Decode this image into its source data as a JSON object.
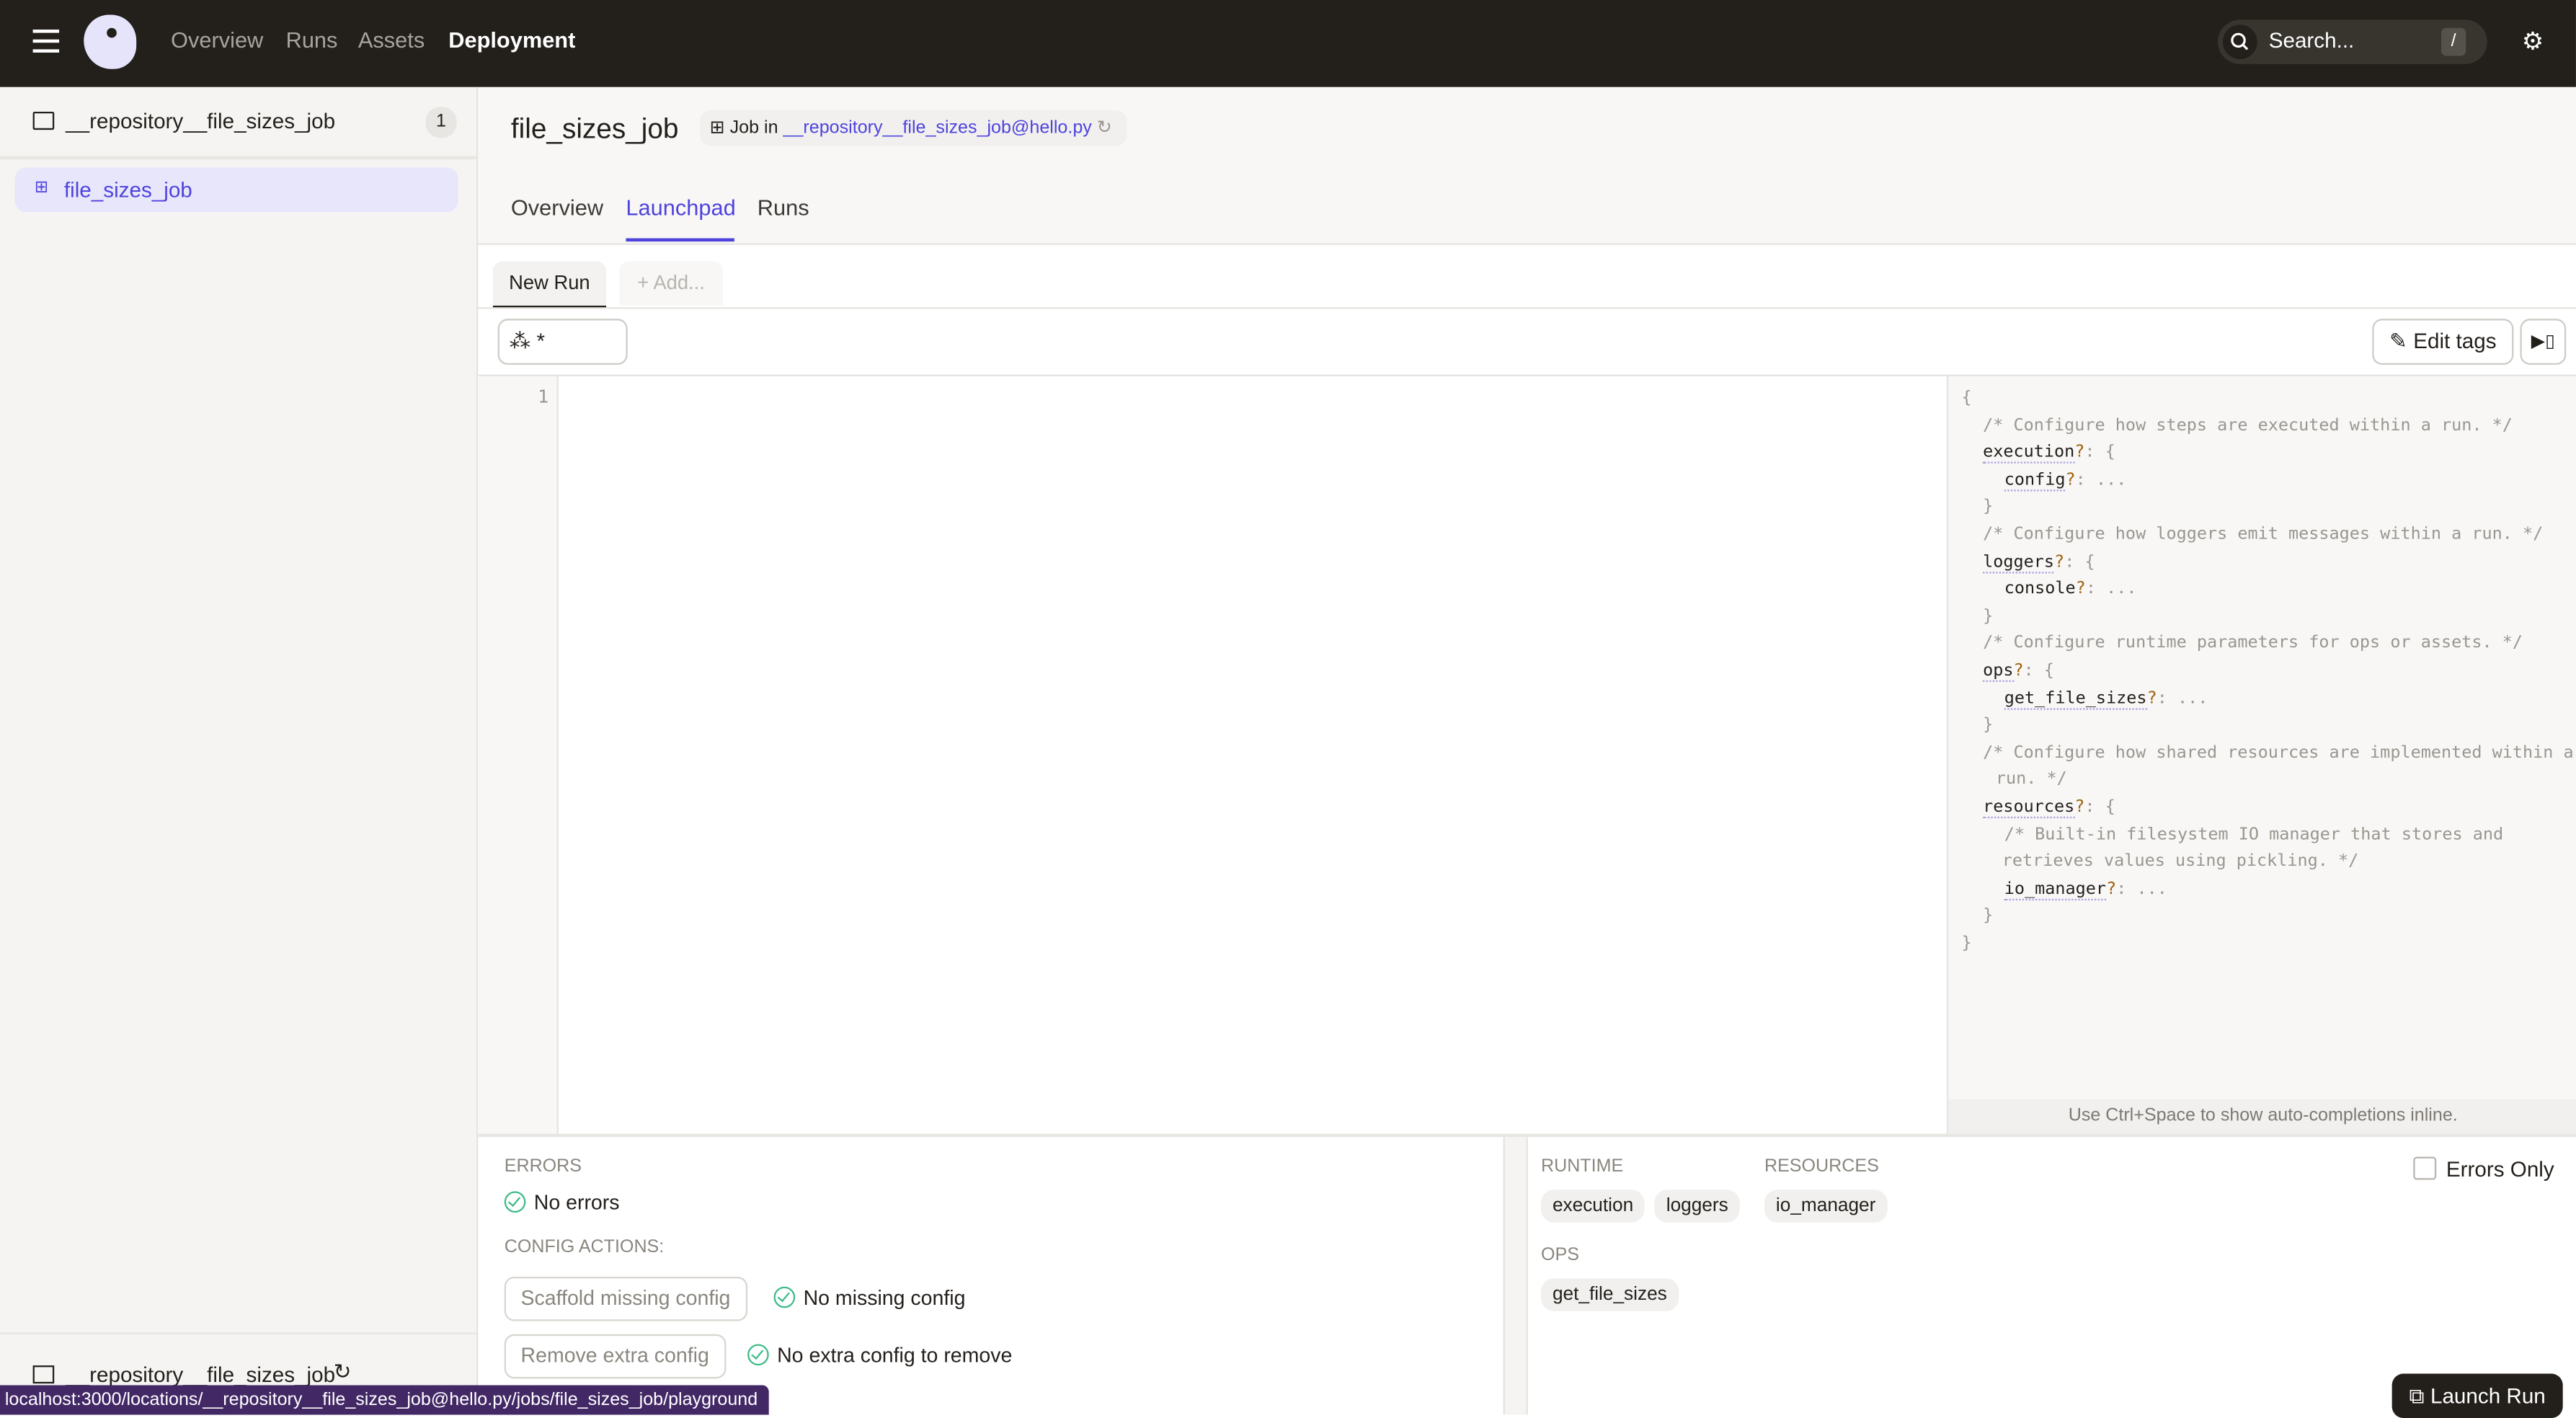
{
  "topbar": {
    "nav": [
      "Overview",
      "Runs",
      "Assets",
      "Deployment"
    ],
    "active": "Deployment",
    "search_placeholder": "Search...",
    "search_shortcut": "/"
  },
  "sidebar": {
    "repo": "__repository__file_sizes_job",
    "repo_count": "1",
    "job": "file_sizes_job",
    "footer_repo": "__repository__file_sizes_job"
  },
  "header": {
    "title": "file_sizes_job",
    "job_in": "Job in",
    "repo_link": "__repository__file_sizes_job@hello.py",
    "tabs": [
      "Overview",
      "Launchpad",
      "Runs"
    ],
    "active_tab": "Launchpad"
  },
  "session_tabs": {
    "new_run": "New Run",
    "add": "+ Add..."
  },
  "op_selector": {
    "value": "*"
  },
  "toolbar": {
    "edit_tags": "Edit tags"
  },
  "editor": {
    "line_numbers": [
      "1"
    ]
  },
  "schema": {
    "lines": [
      {
        "i": 0,
        "t": [
          [
            "p",
            "{"
          ]
        ]
      },
      {
        "i": 1,
        "t": [
          [
            "c",
            "/* Configure how steps are executed within a run. */"
          ]
        ]
      },
      {
        "i": 1,
        "t": [
          [
            "k",
            "execution"
          ],
          [
            "q",
            "?"
          ],
          [
            "p",
            ": {"
          ]
        ]
      },
      {
        "i": 2,
        "t": [
          [
            "k",
            "config"
          ],
          [
            "q",
            "?"
          ],
          [
            "p",
            ": ..."
          ]
        ]
      },
      {
        "i": 1,
        "t": [
          [
            "p",
            "}"
          ]
        ]
      },
      {
        "i": 1,
        "t": [
          [
            "c",
            "/* Configure how loggers emit messages within a run. */"
          ]
        ]
      },
      {
        "i": 1,
        "t": [
          [
            "k",
            "loggers"
          ],
          [
            "q",
            "?"
          ],
          [
            "p",
            ": {"
          ]
        ]
      },
      {
        "i": 2,
        "t": [
          [
            "n",
            "console"
          ],
          [
            "q",
            "?"
          ],
          [
            "p",
            ": ..."
          ]
        ]
      },
      {
        "i": 1,
        "t": [
          [
            "p",
            "}"
          ]
        ]
      },
      {
        "i": 1,
        "t": [
          [
            "c",
            "/* Configure runtime parameters for ops or assets. */"
          ]
        ]
      },
      {
        "i": 1,
        "t": [
          [
            "k",
            "ops"
          ],
          [
            "q",
            "?"
          ],
          [
            "p",
            ": {"
          ]
        ]
      },
      {
        "i": 2,
        "t": [
          [
            "k",
            "get_file_sizes"
          ],
          [
            "q",
            "?"
          ],
          [
            "p",
            ": ..."
          ]
        ]
      },
      {
        "i": 1,
        "t": [
          [
            "p",
            "}"
          ]
        ]
      },
      {
        "i": 1,
        "t": [
          [
            "c",
            "/* Configure how shared resources are implemented within a"
          ]
        ]
      },
      {
        "i": 1.6,
        "t": [
          [
            "c",
            "run. */"
          ]
        ]
      },
      {
        "i": 1,
        "t": [
          [
            "k",
            "resources"
          ],
          [
            "q",
            "?"
          ],
          [
            "p",
            ": {"
          ]
        ]
      },
      {
        "i": 2,
        "t": [
          [
            "c",
            "/* Built-in filesystem IO manager that stores and"
          ]
        ]
      },
      {
        "i": 1.9,
        "t": [
          [
            "c",
            "retrieves values using pickling. */"
          ]
        ]
      },
      {
        "i": 2,
        "t": [
          [
            "k",
            "io_manager"
          ],
          [
            "q",
            "?"
          ],
          [
            "p",
            ": ..."
          ]
        ]
      },
      {
        "i": 1,
        "t": [
          [
            "p",
            "}"
          ]
        ]
      },
      {
        "i": 0,
        "t": [
          [
            "p",
            "}"
          ]
        ]
      }
    ],
    "hint": "Use Ctrl+Space to show auto-completions inline."
  },
  "validation": {
    "errors_label": "ERRORS",
    "no_errors": "No errors",
    "config_actions_label": "CONFIG ACTIONS:",
    "scaffold": "Scaffold missing config",
    "no_missing": "No missing config",
    "remove": "Remove extra config",
    "no_extra": "No extra config to remove"
  },
  "config_tree": {
    "runtime_label": "RUNTIME",
    "runtime": [
      "execution",
      "loggers"
    ],
    "resources_label": "RESOURCES",
    "resources": [
      "io_manager"
    ],
    "ops_label": "OPS",
    "ops": [
      "get_file_sizes"
    ],
    "errors_only": "Errors Only",
    "errors_only_checked": false
  },
  "launch": {
    "label": "Launch Run"
  },
  "status_url": "localhost:3000/locations/__repository__file_sizes_job@hello.py/jobs/file_sizes_job/playground",
  "colors": {
    "accent": "#4f43dd",
    "topbar": "#231f1b",
    "success": "#3ebc87",
    "tooltip": "#432866"
  }
}
